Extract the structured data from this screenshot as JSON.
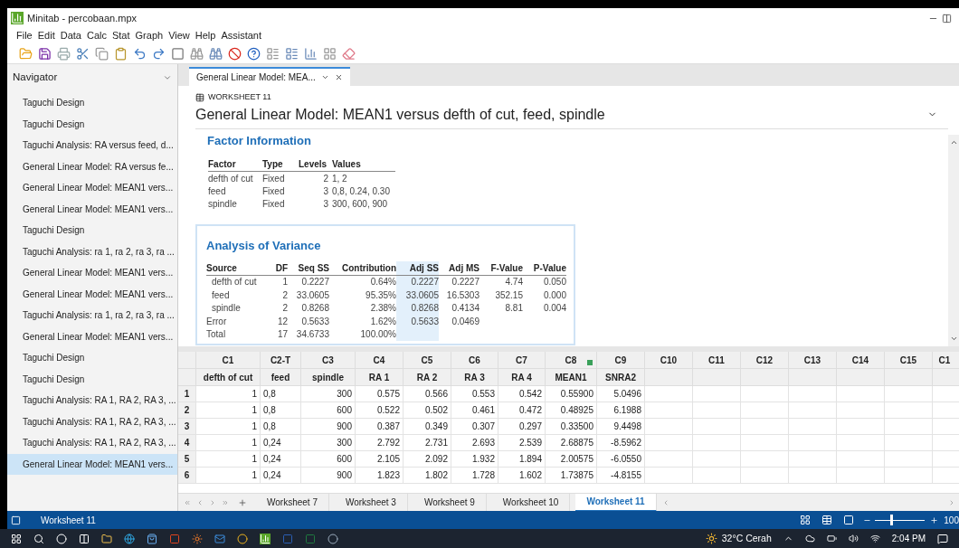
{
  "window": {
    "title": "Minitab - percobaan.mpx"
  },
  "menu": [
    "File",
    "Edit",
    "Data",
    "Calc",
    "Stat",
    "Graph",
    "View",
    "Help",
    "Assistant"
  ],
  "navigator": {
    "title": "Navigator",
    "items": [
      {
        "label": "Taguchi Design",
        "selected": false
      },
      {
        "label": "Taguchi Design",
        "selected": false
      },
      {
        "label": "Taguchi Analysis: RA versus feed, d...",
        "selected": false
      },
      {
        "label": "General Linear Model: RA versus fe...",
        "selected": false
      },
      {
        "label": "General Linear Model: MEAN1 vers...",
        "selected": false
      },
      {
        "label": "General Linear Model: MEAN1 vers...",
        "selected": false
      },
      {
        "label": "Taguchi Design",
        "selected": false
      },
      {
        "label": "Taguchi Analysis: ra 1, ra 2, ra 3, ra ...",
        "selected": false
      },
      {
        "label": "General Linear Model: MEAN1 vers...",
        "selected": false
      },
      {
        "label": "General Linear Model: MEAN1 vers...",
        "selected": false
      },
      {
        "label": "Taguchi Analysis: ra 1, ra 2, ra 3, ra ...",
        "selected": false
      },
      {
        "label": "General Linear Model: MEAN1 vers...",
        "selected": false
      },
      {
        "label": "Taguchi Design",
        "selected": false
      },
      {
        "label": "Taguchi Design",
        "selected": false
      },
      {
        "label": "Taguchi Analysis: RA 1, RA 2, RA 3, ...",
        "selected": false
      },
      {
        "label": "Taguchi Analysis: RA 1, RA 2, RA 3, ...",
        "selected": false
      },
      {
        "label": "Taguchi Analysis: RA 1, RA 2, RA 3, ...",
        "selected": false
      },
      {
        "label": "General Linear Model: MEAN1 vers...",
        "selected": true
      }
    ]
  },
  "output_tab": {
    "label": "General Linear Model: MEA..."
  },
  "output": {
    "worksheet": "WORKSHEET 11",
    "title": "General Linear Model: MEAN1 versus defth of cut, feed, spindle",
    "factor_information": {
      "title": "Factor Information",
      "columns": [
        "Factor",
        "Type",
        "Levels",
        "Values"
      ],
      "rows": [
        [
          "defth of cut",
          "Fixed",
          "2",
          "1, 2"
        ],
        [
          "feed",
          "Fixed",
          "3",
          "0,8, 0.24, 0.30"
        ],
        [
          "spindle",
          "Fixed",
          "3",
          "300, 600, 900"
        ]
      ]
    },
    "analysis_of_variance": {
      "title": "Analysis of Variance",
      "columns": [
        {
          "label": "Source",
          "highlighted": false
        },
        {
          "label": "DF",
          "highlighted": false
        },
        {
          "label": "Seq SS",
          "highlighted": false
        },
        {
          "label": "Contribution",
          "highlighted": false
        },
        {
          "label": "Adj SS",
          "highlighted": true
        },
        {
          "label": "Adj MS",
          "highlighted": false
        },
        {
          "label": "F-Value",
          "highlighted": false
        },
        {
          "label": "P-Value",
          "highlighted": false
        }
      ],
      "rows": [
        {
          "kind": "term",
          "cells": [
            "defth of cut",
            "1",
            "0.2227",
            "0.64%",
            "0.2227",
            "0.2227",
            "4.74",
            "0.050"
          ]
        },
        {
          "kind": "term",
          "cells": [
            "feed",
            "2",
            "33.0605",
            "95.35%",
            "33.0605",
            "16.5303",
            "352.15",
            "0.000"
          ]
        },
        {
          "kind": "term",
          "cells": [
            "spindle",
            "2",
            "0.8268",
            "2.38%",
            "0.8268",
            "0.4134",
            "8.81",
            "0.004"
          ]
        },
        {
          "kind": "summary",
          "cells": [
            "Error",
            "12",
            "0.5633",
            "1.62%",
            "0.5633",
            "0.0469",
            "",
            ""
          ]
        },
        {
          "kind": "summary",
          "cells": [
            "Total",
            "17",
            "34.6733",
            "100.00%",
            "",
            "",
            "",
            ""
          ]
        }
      ]
    }
  },
  "sheet": {
    "columns": [
      {
        "id": "C1",
        "name": "defth of cut",
        "marked": false
      },
      {
        "id": "C2-T",
        "name": "feed",
        "marked": false
      },
      {
        "id": "C3",
        "name": "spindle",
        "marked": false
      },
      {
        "id": "C4",
        "name": "RA 1",
        "marked": false
      },
      {
        "id": "C5",
        "name": "RA 2",
        "marked": false
      },
      {
        "id": "C6",
        "name": "RA 3",
        "marked": false
      },
      {
        "id": "C7",
        "name": "RA 4",
        "marked": false
      },
      {
        "id": "C8",
        "name": "MEAN1",
        "marked": true
      },
      {
        "id": "C9",
        "name": "SNRA2",
        "marked": false
      },
      {
        "id": "C10",
        "marked": false
      },
      {
        "id": "C11",
        "marked": false
      },
      {
        "id": "C12",
        "marked": false
      },
      {
        "id": "C13",
        "marked": false
      },
      {
        "id": "C14",
        "marked": false
      },
      {
        "id": "C15",
        "marked": false
      },
      {
        "id": "C1",
        "marked": false
      }
    ],
    "rows": [
      {
        "number": "1",
        "cells": [
          "1",
          "0,8",
          "300",
          "0.575",
          "0.566",
          "0.553",
          "0.542",
          "0.55900",
          "5.0496"
        ]
      },
      {
        "number": "2",
        "cells": [
          "1",
          "0,8",
          "600",
          "0.522",
          "0.502",
          "0.461",
          "0.472",
          "0.48925",
          "6.1988"
        ]
      },
      {
        "number": "3",
        "cells": [
          "1",
          "0,8",
          "900",
          "0.387",
          "0.349",
          "0.307",
          "0.297",
          "0.33500",
          "9.4498"
        ]
      },
      {
        "number": "4",
        "cells": [
          "1",
          "0,24",
          "300",
          "2.792",
          "2.731",
          "2.693",
          "2.539",
          "2.68875",
          "-8.5962"
        ]
      },
      {
        "number": "5",
        "cells": [
          "1",
          "0,24",
          "600",
          "2.105",
          "2.092",
          "1.932",
          "1.894",
          "2.00575",
          "-6.0550"
        ]
      },
      {
        "number": "6",
        "cells": [
          "1",
          "0,24",
          "900",
          "1.823",
          "1.802",
          "1.728",
          "1.602",
          "1.73875",
          "-4.8155"
        ]
      }
    ]
  },
  "sheet_tabs": [
    {
      "label": "Worksheet 7",
      "selected": false
    },
    {
      "label": "Worksheet 3",
      "selected": false
    },
    {
      "label": "Worksheet 9",
      "selected": false
    },
    {
      "label": "Worksheet 10",
      "selected": false
    },
    {
      "label": "Worksheet 11",
      "selected": true
    }
  ],
  "status_bar": {
    "label": "Worksheet 11",
    "zoom": {
      "level": 0.3,
      "reading": "100"
    }
  },
  "taskbar": {
    "weather": "32°C Cerah",
    "time": "2:04 PM"
  }
}
